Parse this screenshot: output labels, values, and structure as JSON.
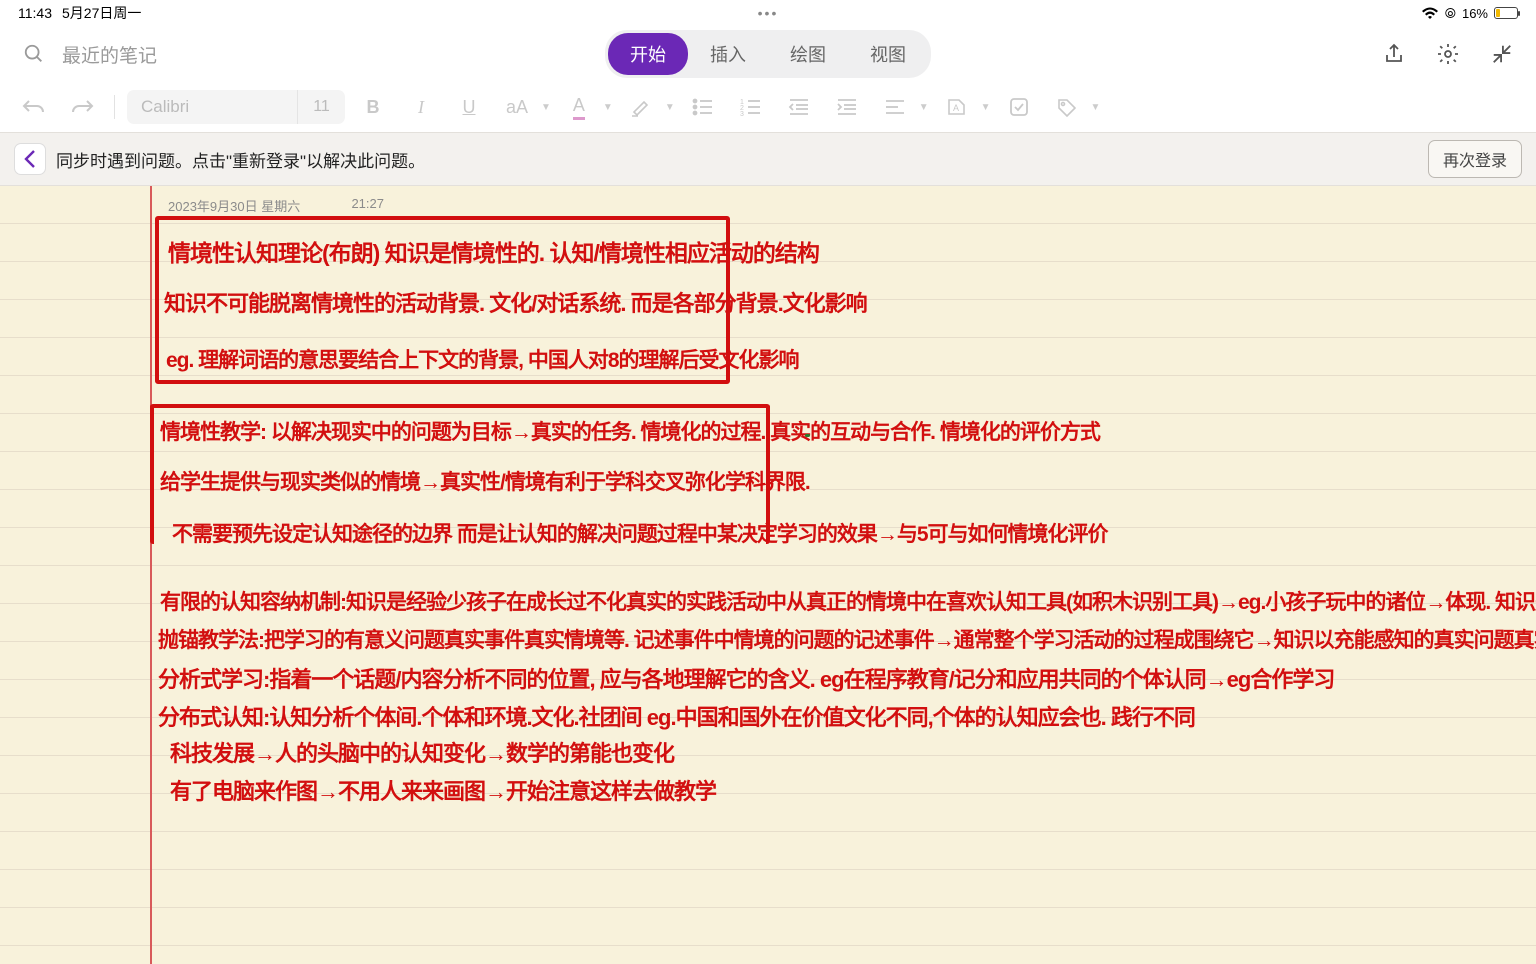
{
  "status": {
    "time": "11:43",
    "date": "5月27日周一",
    "more": "•••",
    "wifi": "wifi",
    "lock": "⊙",
    "battery_pct": "16%"
  },
  "search": {
    "placeholder": "最近的笔记"
  },
  "tabs": {
    "start": "开始",
    "insert": "插入",
    "draw": "绘图",
    "view": "视图"
  },
  "format": {
    "font": "Calibri",
    "size": "11"
  },
  "sync": {
    "message": "同步时遇到问题。点击\"重新登录\"以解决此问题。",
    "relogin": "再次登录"
  },
  "note": {
    "date": "2023年9月30日 星期六",
    "time": "21:27",
    "lines": {
      "l1": "情境性认知理论(布朗)  知识是情境性的. 认知/情境性相应活动的结构",
      "l2": "知识不可能脱离情境性的活动背景. 文化/对话系统. 而是各部分背景.文化影响",
      "l3": "eg. 理解词语的意思要结合上下文的背景, 中国人对8的理解后受文化影响",
      "l4": "情境性教学: 以解决现实中的问题为目标→真实的任务. 情境化的过程. 真实的互动与合作. 情境化的评价方式",
      "l5": "给学生提供与现实类似的情境→真实性/情境有利于学科交叉弥化学科界限.",
      "l6": "不需要预先设定认知途径的边界 而是让认知的解决问题过程中某决定学习的效果→与5可与如何情境化评价",
      "l7": "有限的认知容纳机制:知识是经验少孩子在成长过不化真实的实践活动中从真正的情境中在喜欢认知工具(如积木识别工具)→eg.小孩子玩中的诸位→体现. 知识是情境性的",
      "l8": "抛锚教学法:把学习的有意义问题真实事件真实情境等. 记述事件中情境的问题的记述事件→通常整个学习活动的过程成围绕它→知识以充能感知的真实问题真实事件→情境性认知",
      "l9": "分析式学习:指着一个话题/内容分析不同的位置, 应与各地理解它的含义. eg在程序教育/记分和应用共同的个体认同→eg合作学习",
      "l10": "分布式认知:认知分析个体间.个体和环境.文化.社团间 eg.中国和国外在价值文化不同,个体的认知应会也. 践行不同",
      "l11": "科技发展→人的头脑中的认知变化→数学的第能也变化",
      "l12": "有了电脑来作图→不用人来来画图→开始注意这样去做教学"
    }
  }
}
